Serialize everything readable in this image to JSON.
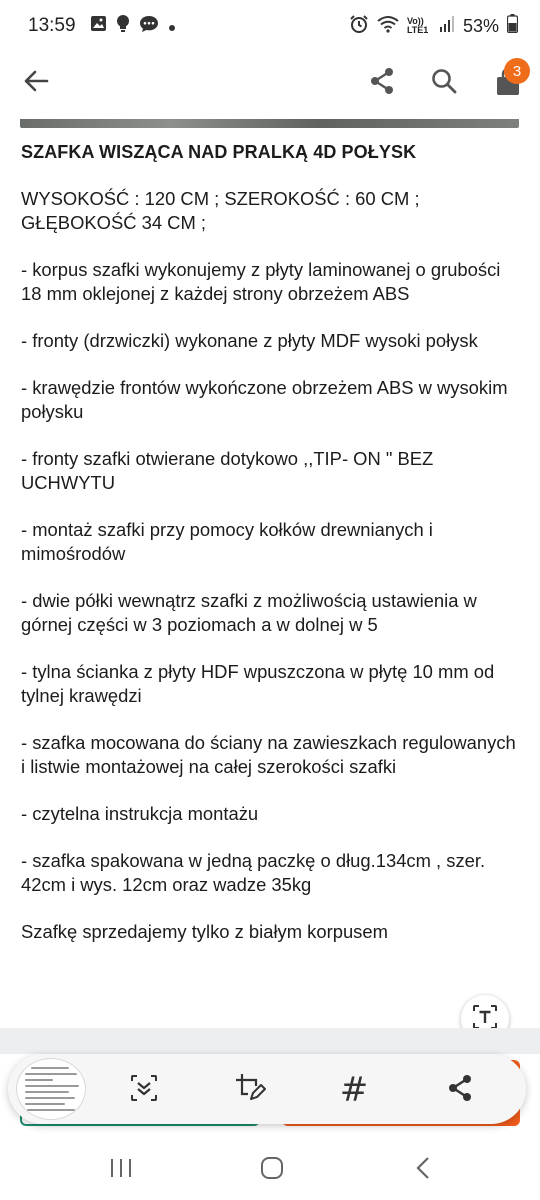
{
  "status_bar": {
    "time": "13:59",
    "network": "Vo)) LTE1",
    "battery": "53%",
    "left_icons": [
      "image-icon",
      "lightbulb-icon",
      "chat-bubble-icon",
      "dot-icon"
    ],
    "right_icons": [
      "alarm-icon",
      "wifi-icon",
      "signal-icon",
      "battery-icon"
    ]
  },
  "app_bar": {
    "icons": [
      "arrow-back-icon",
      "share-icon",
      "search-icon",
      "cart-icon"
    ],
    "cart_badge": "3",
    "accent_color": "#ef6c1a"
  },
  "description": {
    "title": "SZAFKA WISZĄCA NAD PRALKĄ 4D POŁYSK",
    "paragraphs": [
      "WYSOKOŚĆ : 120 CM ;  SZEROKOŚĆ : 60 CM ; GŁĘBOKOŚĆ 34 CM ;",
      "- korpus szafki wykonujemy z płyty laminowanej o grubości 18 mm oklejonej z każdej strony obrzeżem ABS",
      "- fronty (drzwiczki) wykonane z płyty MDF wysoki połysk",
      "- krawędzie frontów wykończone obrzeżem ABS w wysokim połysku",
      "- fronty szafki otwierane dotykowo ,,TIP- ON \" BEZ UCHWYTU",
      "- montaż szafki przy pomocy kołków drewnianych i mimośrodów",
      "- dwie półki wewnątrz szafki z możliwością ustawienia w górnej części w 3 poziomach a w dolnej w 5",
      "- tylna ścianka z płyty HDF wpuszczona w płytę 10 mm od tylnej krawędzi",
      "- szafka mocowana do ściany na zawieszkach regulowanych i listwie montażowej na całej szerokości szafki",
      "- czytelna instrukcja montażu",
      "- szafka spakowana w jedną paczkę o dług.134cm , szer. 42cm i wys. 12cm oraz wadze 35kg",
      "Szafkę sprzedajemy tylko z białym korpusem"
    ]
  },
  "capture_toolbar": {
    "icons": [
      "expand-capture-icon",
      "edit-crop-icon",
      "hashtag-icon",
      "share-icon"
    ]
  },
  "nav_bar": {
    "icons": [
      "recents-icon",
      "home-icon",
      "back-icon"
    ]
  },
  "colors": {
    "primary_orange": "#ef5b1b",
    "secondary_green": "#1b8c6f"
  }
}
